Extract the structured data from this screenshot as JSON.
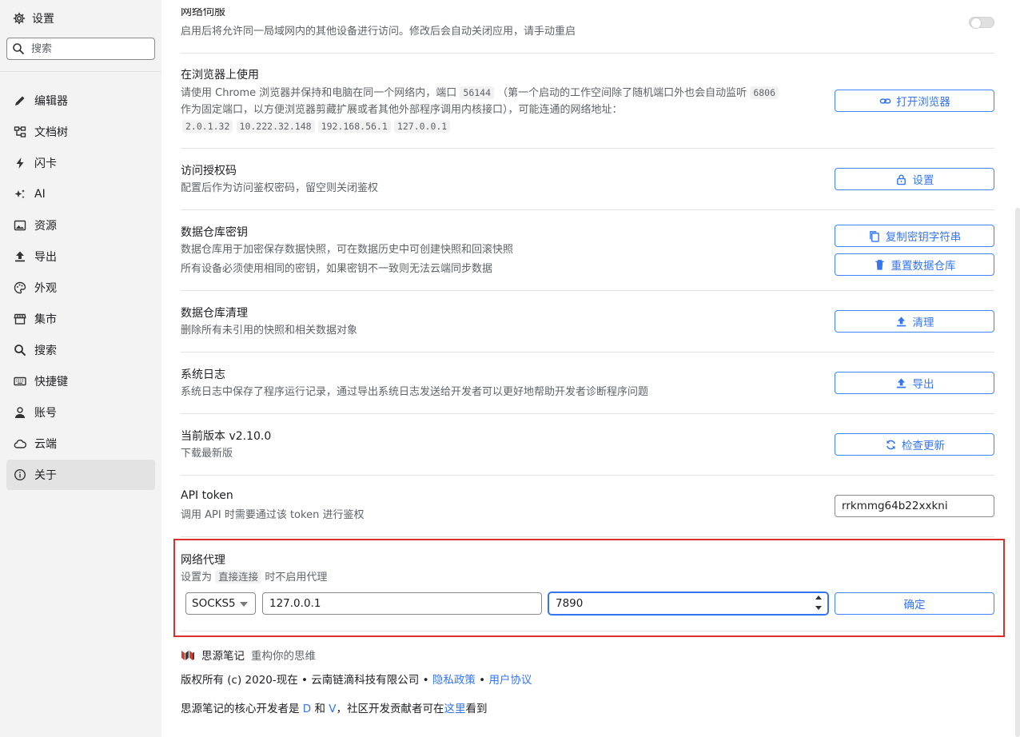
{
  "sidebar": {
    "title": "设置",
    "search_placeholder": "搜索",
    "items": [
      {
        "label": "编辑器",
        "icon": "edit-icon"
      },
      {
        "label": "文档树",
        "icon": "tree-icon"
      },
      {
        "label": "闪卡",
        "icon": "bolt-icon"
      },
      {
        "label": "AI",
        "icon": "sparkle-icon"
      },
      {
        "label": "资源",
        "icon": "image-icon"
      },
      {
        "label": "导出",
        "icon": "upload-icon"
      },
      {
        "label": "外观",
        "icon": "palette-icon"
      },
      {
        "label": "集市",
        "icon": "store-icon"
      },
      {
        "label": "搜索",
        "icon": "search-icon"
      },
      {
        "label": "快捷键",
        "icon": "keyboard-icon"
      },
      {
        "label": "账号",
        "icon": "user-icon"
      },
      {
        "label": "云端",
        "icon": "cloud-icon"
      },
      {
        "label": "关于",
        "icon": "info-icon",
        "active": true
      }
    ]
  },
  "network_serve": {
    "title": "网络伺服",
    "desc": "启用后将允许同一局域网内的其他设备进行访问。修改后会自动关闭应用，请手动重启"
  },
  "browser": {
    "title": "在浏览器上使用",
    "desc_line1_a": "请使用 Chrome 浏览器并保持和电脑在同一个网络内，端口",
    "port": "56144",
    "desc_line1_b": "（第一个启动的工作空间除了随机端口外也会自动监听",
    "fixed_port": "6806",
    "desc_line2": "作为固定端口，以方便浏览器剪藏扩展或者其他外部程序调用内核接口），可能连通的网络地址：",
    "addresses": [
      "2.0.1.32",
      "10.222.32.148",
      "192.168.56.1",
      "127.0.0.1"
    ],
    "button": "打开浏览器"
  },
  "auth_code": {
    "title": "访问授权码",
    "desc": "配置后作为访问鉴权密码，留空则关闭鉴权",
    "button": "设置"
  },
  "repo_key": {
    "title": "数据仓库密钥",
    "desc": "数据仓库用于加密保存数据快照，可在数据历史中可创建快照和回滚快照",
    "warning": "所有设备必须使用相同的密钥，如果密钥不一致则无法云端同步数据",
    "copy_button": "复制密钥字符串",
    "reset_button": "重置数据仓库"
  },
  "repo_purge": {
    "title": "数据仓库清理",
    "desc": "删除所有未引用的快照和相关数据对象",
    "button": "清理"
  },
  "system_log": {
    "title": "系统日志",
    "desc": "系统日志中保存了程序运行记录，通过导出系统日志发送给开发者可以更好地帮助开发者诊断程序问题",
    "button": "导出"
  },
  "version": {
    "title": "当前版本 v2.10.0",
    "download_link": "下载最新版",
    "button": "检查更新"
  },
  "api_token": {
    "title": "API token",
    "desc": "调用 API 时需要通过该 token 进行鉴权",
    "value": "rrkmmg64b22xxkni"
  },
  "proxy": {
    "title": "网络代理",
    "desc_a": "设置为",
    "direct": "直接连接",
    "desc_b": "时不启用代理",
    "scheme": "SOCKS5",
    "host": "127.0.0.1",
    "port": "7890",
    "button": "确定"
  },
  "footer": {
    "brand": "思源笔记",
    "slogan": "重构你的思维",
    "copyright": "版权所有 (c) 2020-现在 • 云南链滴科技有限公司 •",
    "privacy": "隐私政策",
    "dot": "•",
    "agreement": "用户协议",
    "dev_a": "思源笔记的核心开发者是",
    "dev_d": "D",
    "dev_and": "和",
    "dev_v": "V",
    "dev_b": "，社区开发贡献者可在",
    "dev_here": "这里",
    "dev_c": "看到"
  },
  "colors": {
    "accent": "#3575f0",
    "warning": "#d23f31",
    "highlight_border": "#d9302c",
    "sidebar_bg": "#f3f3f3"
  }
}
